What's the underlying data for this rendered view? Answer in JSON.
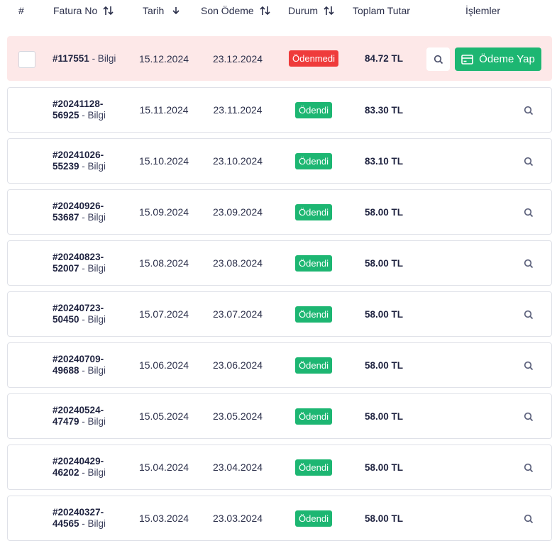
{
  "table": {
    "headers": {
      "index": "#",
      "invoice_no": "Fatura No",
      "date": "Tarih",
      "due_date": "Son Ödeme",
      "status": "Durum",
      "total": "Toplam Tutar",
      "actions": "İşlemler"
    },
    "invoice_suffix": " - Bilgi",
    "pay_button_label": "Ödeme Yap",
    "rows": [
      {
        "no_line1": "#117551",
        "no_line2": "",
        "date": "15.12.2024",
        "due": "23.12.2024",
        "status": "Ödenmedi",
        "total": "84.72 TL"
      },
      {
        "no_line1": "#20241128-",
        "no_line2": "56925",
        "date": "15.11.2024",
        "due": "23.11.2024",
        "status": "Ödendi",
        "total": "83.30 TL"
      },
      {
        "no_line1": "#20241026-",
        "no_line2": "55239",
        "date": "15.10.2024",
        "due": "23.10.2024",
        "status": "Ödendi",
        "total": "83.10 TL"
      },
      {
        "no_line1": "#20240926-",
        "no_line2": "53687",
        "date": "15.09.2024",
        "due": "23.09.2024",
        "status": "Ödendi",
        "total": "58.00 TL"
      },
      {
        "no_line1": "#20240823-",
        "no_line2": "52007",
        "date": "15.08.2024",
        "due": "23.08.2024",
        "status": "Ödendi",
        "total": "58.00 TL"
      },
      {
        "no_line1": "#20240723-",
        "no_line2": "50450",
        "date": "15.07.2024",
        "due": "23.07.2024",
        "status": "Ödendi",
        "total": "58.00 TL"
      },
      {
        "no_line1": "#20240709-",
        "no_line2": "49688",
        "date": "15.06.2024",
        "due": "23.06.2024",
        "status": "Ödendi",
        "total": "58.00 TL"
      },
      {
        "no_line1": "#20240524-",
        "no_line2": "47479",
        "date": "15.05.2024",
        "due": "23.05.2024",
        "status": "Ödendi",
        "total": "58.00 TL"
      },
      {
        "no_line1": "#20240429-",
        "no_line2": "46202",
        "date": "15.04.2024",
        "due": "23.04.2024",
        "status": "Ödendi",
        "total": "58.00 TL"
      },
      {
        "no_line1": "#20240327-",
        "no_line2": "44565",
        "date": "15.03.2024",
        "due": "23.03.2024",
        "status": "Ödendi",
        "total": "58.00 TL"
      }
    ]
  },
  "colors": {
    "paid": "#1db672",
    "unpaid": "#ef3b3b",
    "unpaid_row_bg": "#fde8e8",
    "text": "#1f2340"
  },
  "icons": {
    "sort": "sort-arrows-icon",
    "sort_desc": "arrow-down-icon",
    "view": "search-icon",
    "pay": "credit-card-icon"
  }
}
